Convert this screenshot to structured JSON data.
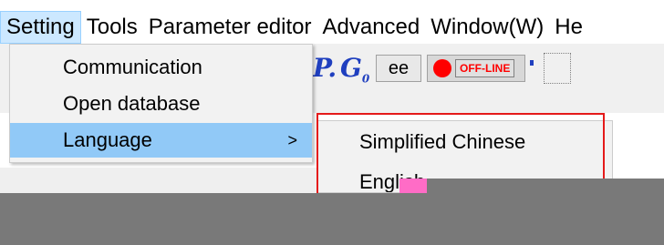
{
  "menubar": {
    "items": [
      {
        "label": "Setting",
        "active": true
      },
      {
        "label": "Tools"
      },
      {
        "label": "Parameter editor"
      },
      {
        "label": "Advanced"
      },
      {
        "label": "Window(W)"
      },
      {
        "label": "He"
      }
    ]
  },
  "toolbar": {
    "p_glyph": "P.",
    "g_glyph": "G",
    "g_sub": "0",
    "ee_label": "ee",
    "status_label": "OFF-LINE",
    "status_color": "#ff0000",
    "accent": "#1f3fbf"
  },
  "setting_menu": {
    "items": [
      {
        "label": "Communication"
      },
      {
        "label": "Open database"
      },
      {
        "label": "Language",
        "arrow": ">",
        "highlight": true
      }
    ],
    "highlight_color": "#91c9f7"
  },
  "language_submenu": {
    "items": [
      {
        "label": "Simplified Chinese"
      },
      {
        "label": "English"
      }
    ],
    "outline_color": "#e51a1a"
  }
}
